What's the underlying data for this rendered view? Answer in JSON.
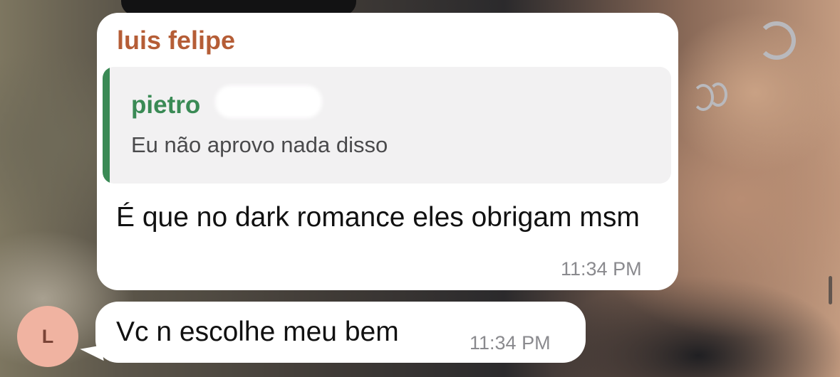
{
  "chat": {
    "messages": [
      {
        "sender": "luis felipe",
        "quote": {
          "author": "pietro",
          "text": "Eu não aprovo nada disso"
        },
        "text": "É que no dark romance eles obrigam msm",
        "time": "11:34 PM"
      },
      {
        "text": "Vc n escolhe meu bem",
        "time": "11:34 PM",
        "avatar_initial": "L"
      }
    ]
  },
  "colors": {
    "sender_name": "#b55d36",
    "quote_accent": "#3a8a55",
    "avatar_bg": "#f0b3a1",
    "bubble_bg": "#ffffff"
  }
}
